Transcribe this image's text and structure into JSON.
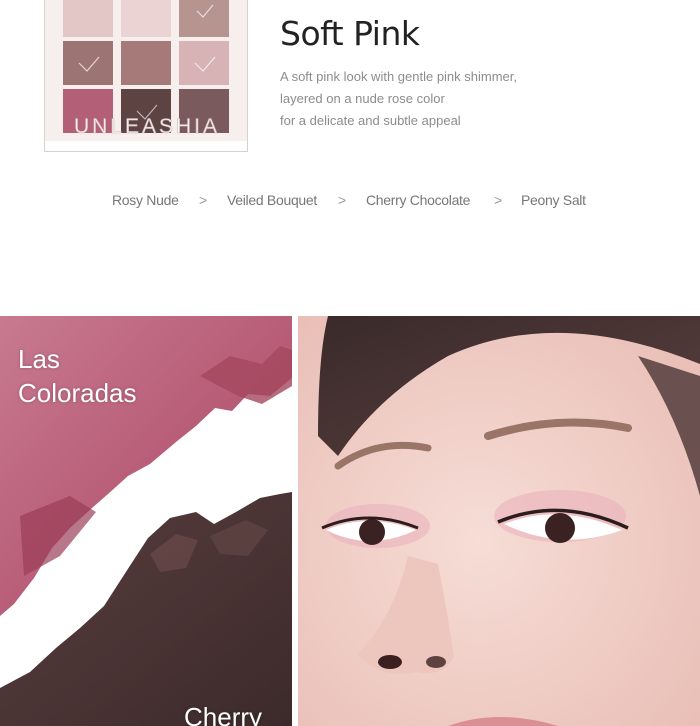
{
  "product": {
    "brand": "UNLEASHIA",
    "pan_colors": [
      "#e3c7c7",
      "#ead3d2",
      "#b69490",
      "#9c7473",
      "#a57a78",
      "#d7b3b6",
      "#b45f78",
      "#5d4342",
      "#7a5a5d"
    ]
  },
  "shade": {
    "title": "Soft Pink",
    "description_lines": [
      "A soft pink look with gentle pink shimmer,",
      "layered on a nude rose color",
      "for a delicate and subtle appeal"
    ]
  },
  "shade_nav": {
    "items": [
      "Rosy Nude",
      "Veiled Bouquet",
      "Cherry Chocolate",
      "Peony Salt"
    ],
    "separator": ">"
  },
  "swatch_photo": {
    "label_top_line1": "Las",
    "label_top_line2": "Coloradas",
    "label_bottom": "Cherry"
  },
  "colors": {
    "pink_shimmer": "#c46a82",
    "chocolate": "#4b3434",
    "skin": "#f1d4cd"
  }
}
